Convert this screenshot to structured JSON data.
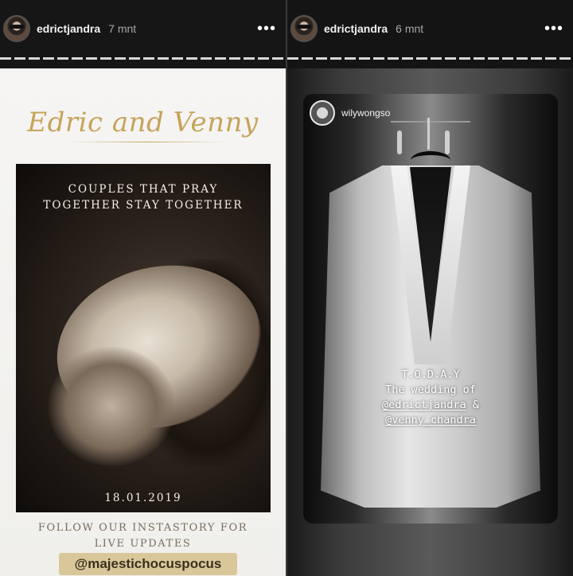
{
  "stories": [
    {
      "username": "edrictjandra",
      "timestamp": "7 mnt",
      "more_label": "•••",
      "script_title": "Edric and Venny",
      "caption_lines": [
        "COUPLES THAT PRAY",
        "TOGETHER STAY TOGETHER"
      ],
      "date": "18.01.2019",
      "follow_lines": [
        "FOLLOW OUR INSTASTORY FOR",
        "LIVE UPDATES"
      ],
      "mention": "@majestichocuspocus"
    },
    {
      "username": "edrictjandra",
      "timestamp": "6 mnt",
      "more_label": "•••",
      "repost_username": "wilywongso",
      "caption_lines": [
        "T.O.D.A.Y",
        "The wedding of"
      ],
      "mentions": [
        "@edrictjandra",
        "@venny_chandra"
      ],
      "mention_joiner": " &"
    }
  ],
  "colors": {
    "gold": "#c6a35b",
    "mention_bg": "#d9c79a",
    "header_bg": "#262626"
  }
}
